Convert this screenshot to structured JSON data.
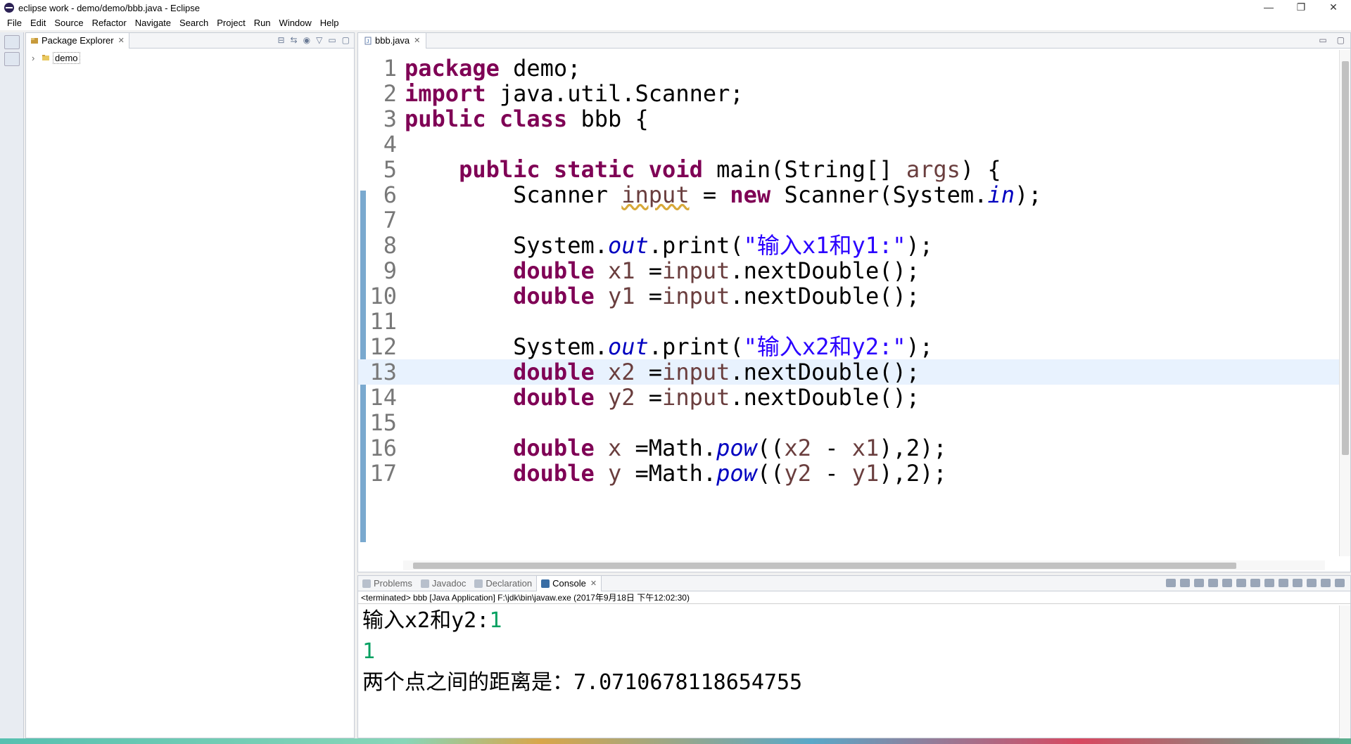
{
  "window": {
    "title": "eclipse work - demo/demo/bbb.java - Eclipse",
    "minimize": "—",
    "restore": "❐",
    "close": "✕"
  },
  "menu": [
    "File",
    "Edit",
    "Source",
    "Refactor",
    "Navigate",
    "Search",
    "Project",
    "Run",
    "Window",
    "Help"
  ],
  "package_explorer": {
    "tab_label": "Package Explorer",
    "tree": [
      {
        "label": "demo",
        "expanded": false
      }
    ]
  },
  "editor": {
    "tab_label": "bbb.java",
    "current_line": 13,
    "lines": [
      {
        "n": "1",
        "tokens": [
          [
            "kw",
            "package"
          ],
          [
            "",
            " demo;"
          ]
        ]
      },
      {
        "n": "2",
        "tokens": [
          [
            "kw",
            "import"
          ],
          [
            "",
            " java.util.Scanner;"
          ]
        ]
      },
      {
        "n": "3",
        "tokens": [
          [
            "kw",
            "public"
          ],
          [
            "",
            " "
          ],
          [
            "kw",
            "class"
          ],
          [
            "",
            " bbb {"
          ]
        ]
      },
      {
        "n": "4",
        "tokens": []
      },
      {
        "n": "5",
        "tokens": [
          [
            "",
            "    "
          ],
          [
            "kw",
            "public"
          ],
          [
            "",
            " "
          ],
          [
            "kw",
            "static"
          ],
          [
            "",
            " "
          ],
          [
            "kw",
            "void"
          ],
          [
            "",
            " main(String[] "
          ],
          [
            "lv",
            "args"
          ],
          [
            "",
            ") {"
          ]
        ]
      },
      {
        "n": "6",
        "tokens": [
          [
            "",
            "        Scanner "
          ],
          [
            "lv warn",
            "input"
          ],
          [
            "",
            " = "
          ],
          [
            "kw",
            "new"
          ],
          [
            "",
            " Scanner(System."
          ],
          [
            "fld",
            "in"
          ],
          [
            "",
            ");"
          ]
        ]
      },
      {
        "n": "7",
        "tokens": []
      },
      {
        "n": "8",
        "tokens": [
          [
            "",
            "        System."
          ],
          [
            "fld",
            "out"
          ],
          [
            "",
            ".print("
          ],
          [
            "str",
            "\"输入x1和y1:\""
          ],
          [
            "",
            ");"
          ]
        ]
      },
      {
        "n": "9",
        "tokens": [
          [
            "",
            "        "
          ],
          [
            "kw",
            "double"
          ],
          [
            "",
            " "
          ],
          [
            "lv",
            "x1"
          ],
          [
            "",
            " ="
          ],
          [
            "lv",
            "input"
          ],
          [
            "",
            ".nextDouble();"
          ]
        ]
      },
      {
        "n": "10",
        "tokens": [
          [
            "",
            "        "
          ],
          [
            "kw",
            "double"
          ],
          [
            "",
            " "
          ],
          [
            "lv",
            "y1"
          ],
          [
            "",
            " ="
          ],
          [
            "lv",
            "input"
          ],
          [
            "",
            ".nextDouble();"
          ]
        ]
      },
      {
        "n": "11",
        "tokens": []
      },
      {
        "n": "12",
        "tokens": [
          [
            "",
            "        System."
          ],
          [
            "fld",
            "out"
          ],
          [
            "",
            ".print("
          ],
          [
            "str",
            "\"输入x2和y2:\""
          ],
          [
            "",
            ");"
          ]
        ]
      },
      {
        "n": "13",
        "tokens": [
          [
            "",
            "        "
          ],
          [
            "kw",
            "double"
          ],
          [
            "",
            " "
          ],
          [
            "lv",
            "x2"
          ],
          [
            "",
            " ="
          ],
          [
            "lv",
            "input"
          ],
          [
            "",
            ".nextDouble();"
          ]
        ]
      },
      {
        "n": "14",
        "tokens": [
          [
            "",
            "        "
          ],
          [
            "kw",
            "double"
          ],
          [
            "",
            " "
          ],
          [
            "lv",
            "y2"
          ],
          [
            "",
            " ="
          ],
          [
            "lv",
            "input"
          ],
          [
            "",
            ".nextDouble();"
          ]
        ]
      },
      {
        "n": "15",
        "tokens": []
      },
      {
        "n": "16",
        "tokens": [
          [
            "",
            "        "
          ],
          [
            "kw",
            "double"
          ],
          [
            "",
            " "
          ],
          [
            "lv",
            "x"
          ],
          [
            "",
            " =Math."
          ],
          [
            "fld",
            "pow"
          ],
          [
            "",
            "(("
          ],
          [
            "lv",
            "x2"
          ],
          [
            "",
            " - "
          ],
          [
            "lv",
            "x1"
          ],
          [
            "",
            "),2);"
          ]
        ]
      },
      {
        "n": "17",
        "tokens": [
          [
            "",
            "        "
          ],
          [
            "kw",
            "double"
          ],
          [
            "",
            " "
          ],
          [
            "lv",
            "y"
          ],
          [
            "",
            " =Math."
          ],
          [
            "fld",
            "pow"
          ],
          [
            "",
            "(("
          ],
          [
            "lv",
            "y2"
          ],
          [
            "",
            " - "
          ],
          [
            "lv",
            "y1"
          ],
          [
            "",
            "),2);"
          ]
        ]
      }
    ]
  },
  "console": {
    "tabs": [
      {
        "label": "Problems",
        "active": false
      },
      {
        "label": "Javadoc",
        "active": false
      },
      {
        "label": "Declaration",
        "active": false
      },
      {
        "label": "Console",
        "active": true
      }
    ],
    "status": "<terminated> bbb [Java Application] F:\\jdk\\bin\\javaw.exe (2017年9月18日 下午12:02:30)",
    "output": [
      {
        "text": "输入x2和y2:",
        "input": "1"
      },
      {
        "text": "",
        "input": "1"
      },
      {
        "text": "两个点之间的距离是：7.0710678118654755",
        "input": ""
      }
    ]
  }
}
